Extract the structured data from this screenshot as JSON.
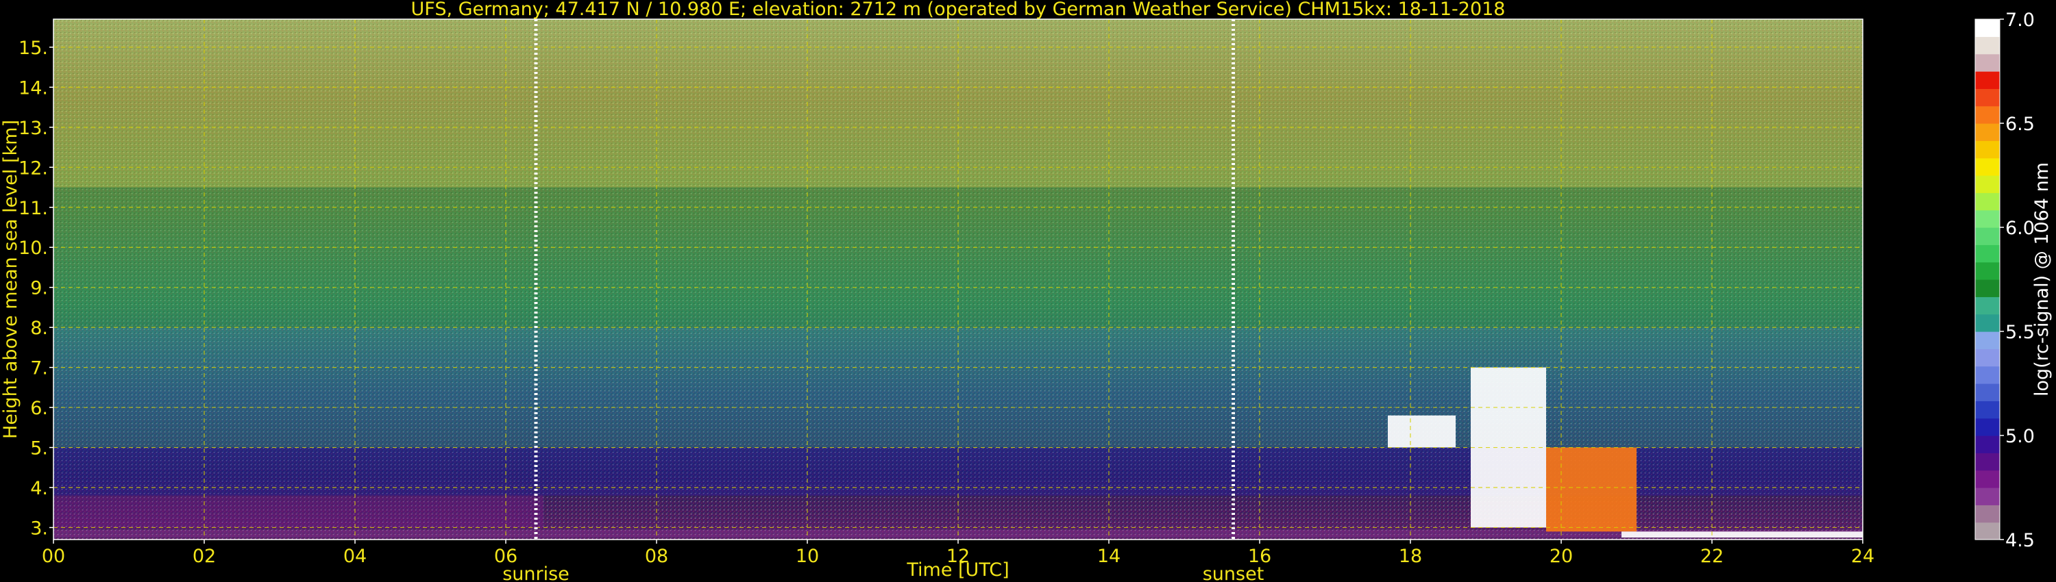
{
  "chart_data": {
    "type": "heatmap",
    "title": "UFS, Germany; 47.417 N / 10.980 E; elevation: 2712 m  (operated by German Weather Service)    CHM15kx: 18-11-2018",
    "xlabel": "Time [UTC]",
    "ylabel": "Height above mean sea level [km]",
    "xlim": [
      0,
      24
    ],
    "ylim": [
      2.7,
      15.7
    ],
    "x_ticks": [
      0,
      2,
      4,
      6,
      8,
      10,
      12,
      14,
      16,
      18,
      20,
      22,
      24
    ],
    "x_tick_labels": [
      "00",
      "02",
      "04",
      "06",
      "08",
      "10",
      "12",
      "14",
      "16",
      "18",
      "20",
      "22",
      "24"
    ],
    "y_ticks": [
      3,
      4,
      5,
      6,
      7,
      8,
      9,
      10,
      11,
      12,
      13,
      14,
      15
    ],
    "y_tick_labels": [
      "3.",
      "4.",
      "5.",
      "6.",
      "7.",
      "8.",
      "9.",
      "10.",
      "11.",
      "12.",
      "13.",
      "14.",
      "15."
    ],
    "grid": true,
    "annotations": [
      {
        "text": "sunrise",
        "x": 6.4
      },
      {
        "text": "sunset",
        "x": 15.65
      }
    ],
    "colorbar": {
      "label": "log(rc-signal) @ 1064 nm",
      "range": [
        4.5,
        7.0
      ],
      "tick_values": [
        4.5,
        5.0,
        5.5,
        6.0,
        6.5,
        7.0
      ],
      "tick_labels": [
        "4.5",
        "5.0",
        "5.5",
        "6.0",
        "6.5",
        "7.0"
      ],
      "colors": [
        "#b0a0a8",
        "#a07898",
        "#8a3a98",
        "#7a1a8c",
        "#5a108a",
        "#3a109a",
        "#2020b0",
        "#2a3ec0",
        "#4a62d0",
        "#6a80e0",
        "#8a98e8",
        "#8aa8ea",
        "#2a9e8e",
        "#3ab08a",
        "#1a8a2a",
        "#22a83a",
        "#3ac85a",
        "#5ad872",
        "#7ae87a",
        "#a8f048",
        "#d8f020",
        "#f8e800",
        "#f8c800",
        "#f8a010",
        "#f87818",
        "#f04818",
        "#e81808",
        "#d0b0b8",
        "#e8e0d8",
        "#ffffff"
      ]
    },
    "layers": [
      {
        "x": [
          0,
          24
        ],
        "y": [
          2.75,
          2.95
        ],
        "value": 4.7
      },
      {
        "x": [
          0,
          6.5
        ],
        "y": [
          3.0,
          3.8
        ],
        "value": 4.8
      },
      {
        "x": [
          0,
          24
        ],
        "y": [
          3.8,
          5.0
        ],
        "value": 5.0
      },
      {
        "x": [
          0,
          24
        ],
        "y": [
          5.0,
          8.0
        ],
        "value": 5.5
      },
      {
        "x": [
          0,
          24
        ],
        "y": [
          8.0,
          11.5
        ],
        "value": 5.8
      },
      {
        "x": [
          0,
          24
        ],
        "y": [
          11.5,
          15.7
        ],
        "value": 6.1
      }
    ],
    "cloud_features": [
      {
        "x": [
          17.7,
          18.6
        ],
        "y": [
          5.0,
          5.8
        ],
        "value": 7.0
      },
      {
        "x": [
          18.8,
          19.8
        ],
        "y": [
          3.0,
          7.0
        ],
        "value": 7.0
      },
      {
        "x": [
          19.8,
          21.0
        ],
        "y": [
          2.9,
          5.0
        ],
        "value": 6.5
      },
      {
        "x": [
          20.8,
          24.0
        ],
        "y": [
          2.75,
          2.9
        ],
        "value": 7.0
      }
    ]
  }
}
